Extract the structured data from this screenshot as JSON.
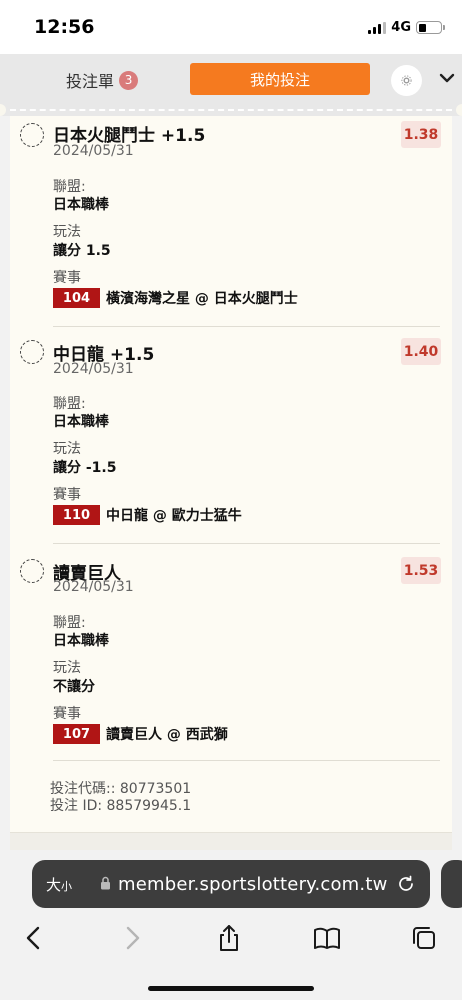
{
  "status_bar": {
    "time": "12:56",
    "network": "4G"
  },
  "header": {
    "betslip_label": "投注單",
    "betslip_count": "3",
    "mybets_label": "我的投注"
  },
  "bets": [
    {
      "title": "日本火腿鬥士 +1.5",
      "date": "2024/05/31",
      "odds": "1.38",
      "league_label": "聯盟:",
      "league": "日本職棒",
      "bettype_label": "玩法",
      "bettype": "讓分 1.5",
      "event_label": "賽事",
      "match_id": "104",
      "match": "橫濱海灣之星 @ 日本火腿鬥士"
    },
    {
      "title": "中日龍 +1.5",
      "date": "2024/05/31",
      "odds": "1.40",
      "league_label": "聯盟:",
      "league": "日本職棒",
      "bettype_label": "玩法",
      "bettype": "讓分 -1.5",
      "event_label": "賽事",
      "match_id": "110",
      "match": "中日龍 @ 歐力士猛牛"
    },
    {
      "title": "讀賣巨人",
      "date": "2024/05/31",
      "odds": "1.53",
      "league_label": "聯盟:",
      "league": "日本職棒",
      "bettype_label": "玩法",
      "bettype": "不讓分",
      "event_label": "賽事",
      "match_id": "107",
      "match": "讀賣巨人 @ 西武獅"
    }
  ],
  "footer": {
    "bet_code": "投注代碼:: 80773501",
    "bet_id": "投注 ID: 88579945.1"
  },
  "browser": {
    "text_size_big": "大",
    "text_size_small": "小",
    "url": "member.sportslottery.com.tw"
  },
  "colors": {
    "accent": "#f57a1f",
    "odds_text": "#c0392b",
    "match_badge": "#b01515"
  }
}
